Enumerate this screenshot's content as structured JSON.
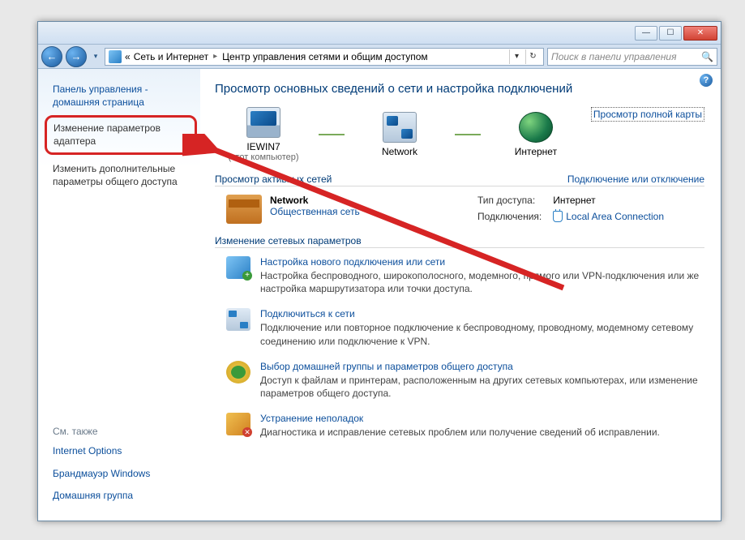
{
  "titlebar": {
    "minimize_glyph": "—",
    "maximize_glyph": "☐",
    "close_glyph": "✕"
  },
  "nav": {
    "back_glyph": "←",
    "fwd_glyph": "→",
    "history_glyph": "▾",
    "breadcrumb_prefix": "«",
    "crumb1": "Сеть и Интернет",
    "crumb_sep": "▸",
    "crumb2": "Центр управления сетями и общим доступом",
    "dd_glyph": "▾",
    "refresh_glyph": "↻",
    "search_placeholder": "Поиск в панели управления",
    "search_glyph": "🔍"
  },
  "sidebar": {
    "home": "Панель управления - домашняя страница",
    "adapter": "Изменение параметров адаптера",
    "advanced": "Изменить дополнительные параметры общего доступа",
    "see_also_hdr": "См. также",
    "see_also": {
      "0": "Internet Options",
      "1": "Брандмауэр Windows",
      "2": "Домашняя группа"
    }
  },
  "main": {
    "help_glyph": "?",
    "title": "Просмотр основных сведений о сети и настройка подключений",
    "map": {
      "pc_name": "IEWIN7",
      "pc_sub": "(этот компьютер)",
      "net": "Network",
      "inet": "Интернет",
      "full_map": "Просмотр полной карты"
    },
    "active_hdr": "Просмотр активных сетей",
    "active_link": "Подключение или отключение",
    "network": {
      "name": "Network",
      "type": "Общественная сеть",
      "access_lbl": "Тип доступа:",
      "access_val": "Интернет",
      "conn_lbl": "Подключения:",
      "conn_val": "Local Area Connection"
    },
    "change_hdr": "Изменение сетевых параметров",
    "tasks": {
      "0": {
        "title": "Настройка нового подключения или сети",
        "desc": "Настройка беспроводного, широкополосного, модемного, прямого или VPN-подключения или же настройка маршрутизатора или точки доступа."
      },
      "1": {
        "title": "Подключиться к сети",
        "desc": "Подключение или повторное подключение к беспроводному, проводному, модемному сетевому соединению или подключение к VPN."
      },
      "2": {
        "title": "Выбор домашней группы и параметров общего доступа",
        "desc": "Доступ к файлам и принтерам, расположенным на других сетевых компьютерах, или изменение параметров общего доступа."
      },
      "3": {
        "title": "Устранение неполадок",
        "desc": "Диагностика и исправление сетевых проблем или получение сведений об исправлении."
      }
    }
  }
}
